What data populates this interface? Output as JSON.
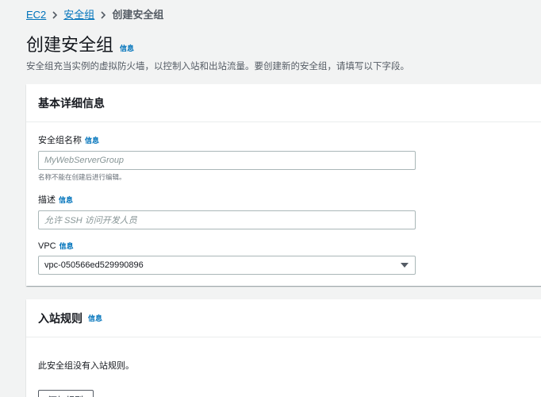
{
  "breadcrumb": {
    "items": [
      "EC2",
      "安全组"
    ],
    "current": "创建安全组"
  },
  "page": {
    "title": "创建安全组",
    "info": "信息",
    "description": "安全组充当实例的虚拟防火墙，以控制入站和出站流量。要创建新的安全组，请填写以下字段。"
  },
  "basic": {
    "title": "基本详细信息",
    "name": {
      "label": "安全组名称",
      "info": "信息",
      "placeholder": "MyWebServerGroup",
      "constraint": "名称不能在创建后进行编辑。"
    },
    "description": {
      "label": "描述",
      "info": "信息",
      "placeholder": "允许 SSH 访问开发人员"
    },
    "vpc": {
      "label": "VPC",
      "info": "信息",
      "value": "vpc-050566ed529990896"
    }
  },
  "inbound": {
    "title": "入站规则",
    "info": "信息",
    "empty": "此安全组没有入站规则。",
    "add_button": "添加规则"
  }
}
